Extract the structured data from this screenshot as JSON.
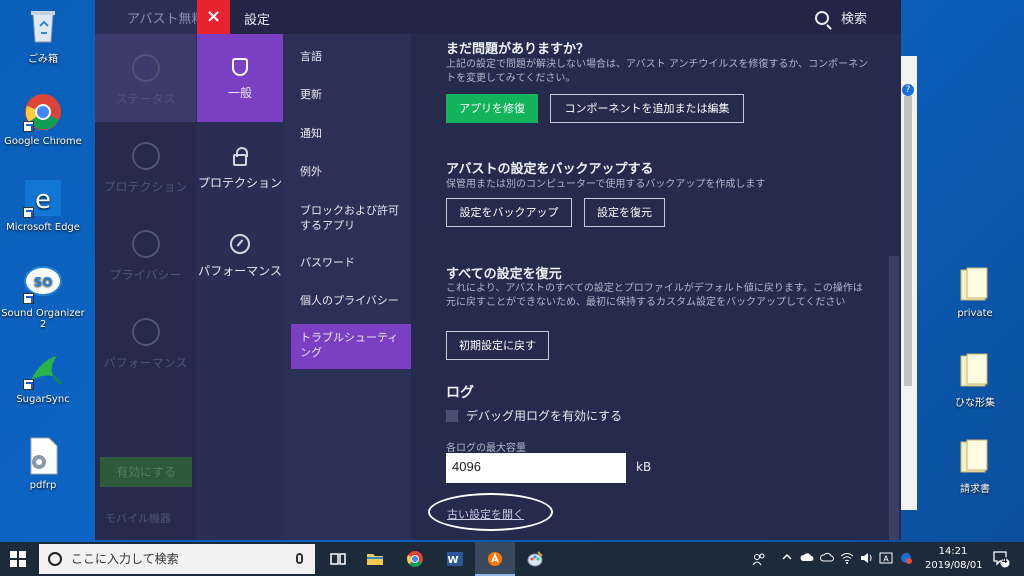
{
  "desktop": {
    "icons": [
      {
        "label": "ごみ箱"
      },
      {
        "label": "Google Chrome"
      },
      {
        "label": "Microsoft Edge"
      },
      {
        "label": "Sound Organizer 2"
      },
      {
        "label": "SugarSync"
      },
      {
        "label": "pdfrp"
      }
    ],
    "right_icons": [
      {
        "label": "private"
      },
      {
        "label": "ひな形集"
      },
      {
        "label": "請求書"
      }
    ]
  },
  "bg_window": {
    "title": "アバスト無料",
    "nav": [
      "ステータス",
      "プロテクション",
      "プライバシー",
      "パフォーマンス"
    ],
    "enable_button": "有効にする",
    "mobile_label": "モバイル機器"
  },
  "dialog": {
    "close_label": "×",
    "title": "設定",
    "search_label": "検索",
    "categories": [
      {
        "label": "一般",
        "icon": "shield-icon"
      },
      {
        "label": "プロテクション",
        "icon": "lock-icon"
      },
      {
        "label": "パフォーマンス",
        "icon": "gauge-icon"
      }
    ],
    "subnav": [
      {
        "label": "言語"
      },
      {
        "label": "更新"
      },
      {
        "label": "通知"
      },
      {
        "label": "例外"
      },
      {
        "label": "ブロックおよび許可するアプリ"
      },
      {
        "label": "パスワード"
      },
      {
        "label": "個人のプライバシー"
      },
      {
        "label": "トラブルシューティング"
      }
    ],
    "repair": {
      "title": "まだ問題がありますか？",
      "desc": "上記の設定で問題が解決しない場合は、アバスト アンチウイルスを修復するか、コンポーネントを変更してみてください。",
      "repair_button": "アプリを修復",
      "components_button": "コンポーネントを追加または編集"
    },
    "backup": {
      "title": "アバストの設定をバックアップする",
      "desc": "保管用または別のコンピューターで使用するバックアップを作成します",
      "backup_button": "設定をバックアップ",
      "restore_button": "設定を復元"
    },
    "reset": {
      "title": "すべての設定を復元",
      "desc": "これにより、アバストのすべての設定とプロファイルがデフォルト値に戻ります。この操作は元に戻すことができないため、最初に保持するカスタム設定をバックアップしてください",
      "reset_button": "初期設定に戻す"
    },
    "log": {
      "title": "ログ",
      "debug_label": "デバッグ用ログを有効にする",
      "max_size_label": "各ログの最大容量",
      "max_size_value": "4096",
      "unit": "kB"
    },
    "old_settings_link": "古い設定を開く"
  },
  "taskbar": {
    "search_placeholder": "ここに入力して検索",
    "time": "14:21",
    "date": "2019/08/01",
    "notification_count": "4",
    "accent": "#7b3fc4"
  }
}
